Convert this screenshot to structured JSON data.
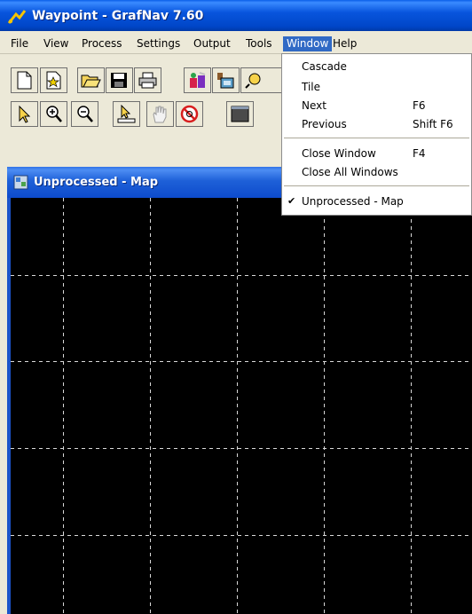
{
  "window": {
    "title": "Waypoint - GrafNav 7.60"
  },
  "menubar": {
    "items": [
      "File",
      "View",
      "Process",
      "Settings",
      "Output",
      "Tools",
      "Window",
      "Help"
    ]
  },
  "window_menu": {
    "items": [
      {
        "label": "Cascade",
        "shortcut": ""
      },
      {
        "label": "Tile",
        "shortcut": ""
      },
      {
        "label": "Next",
        "shortcut": "F6"
      },
      {
        "label": "Previous",
        "shortcut": "Shift F6"
      },
      {
        "label": "Close Window",
        "shortcut": "F4"
      },
      {
        "label": "Close All Windows",
        "shortcut": ""
      },
      {
        "label": "Unprocessed - Map",
        "shortcut": "",
        "checked": true
      }
    ],
    "check_mark": "✔"
  },
  "map_window": {
    "title": "Unprocessed - Map"
  },
  "colors": {
    "title_bar": "#0054e3",
    "menu_highlight": "#316ac5",
    "map_background": "#000000",
    "grid": "#d8d8d8"
  }
}
